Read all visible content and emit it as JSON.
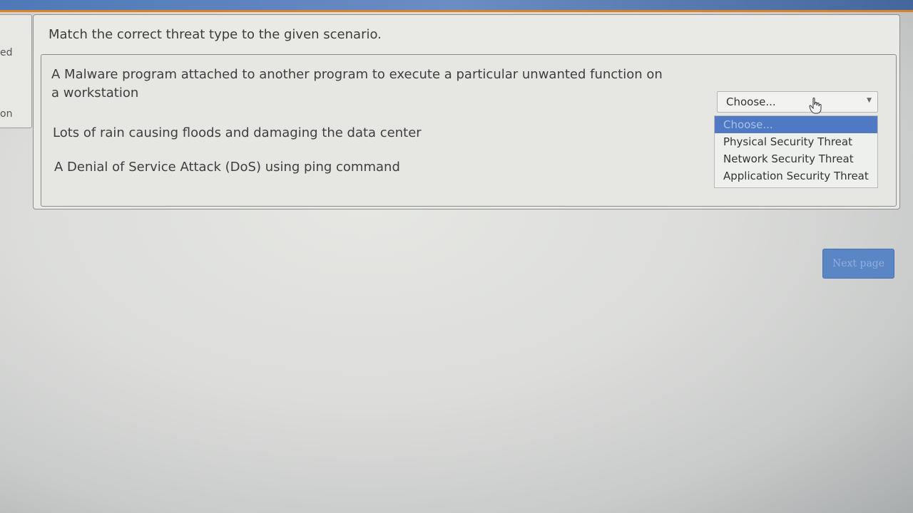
{
  "side": {
    "text1": "ed",
    "text2": "on"
  },
  "question": {
    "title": "Match the correct threat type to the given scenario.",
    "scenarios": [
      "A Malware program attached to another program to execute a particular unwanted function on a workstation",
      "Lots of rain causing floods and damaging the data center",
      "A Denial of Service Attack (DoS) using ping command"
    ]
  },
  "select": {
    "value": "Choose...",
    "options": [
      "Choose...",
      "Physical Security Threat",
      "Network Security Threat",
      "Application Security Threat"
    ],
    "highlighted_option": "Choose..."
  },
  "next_button": {
    "label": "Next page"
  },
  "colors": {
    "accent": "#5b86c6",
    "highlight": "#4f7ac3",
    "top_bar": "#4d79b8",
    "top_bar_border": "#d9822b"
  },
  "icons": {
    "dropdown_arrow": "chevron-down-icon",
    "cursor": "hand-pointer-icon"
  }
}
